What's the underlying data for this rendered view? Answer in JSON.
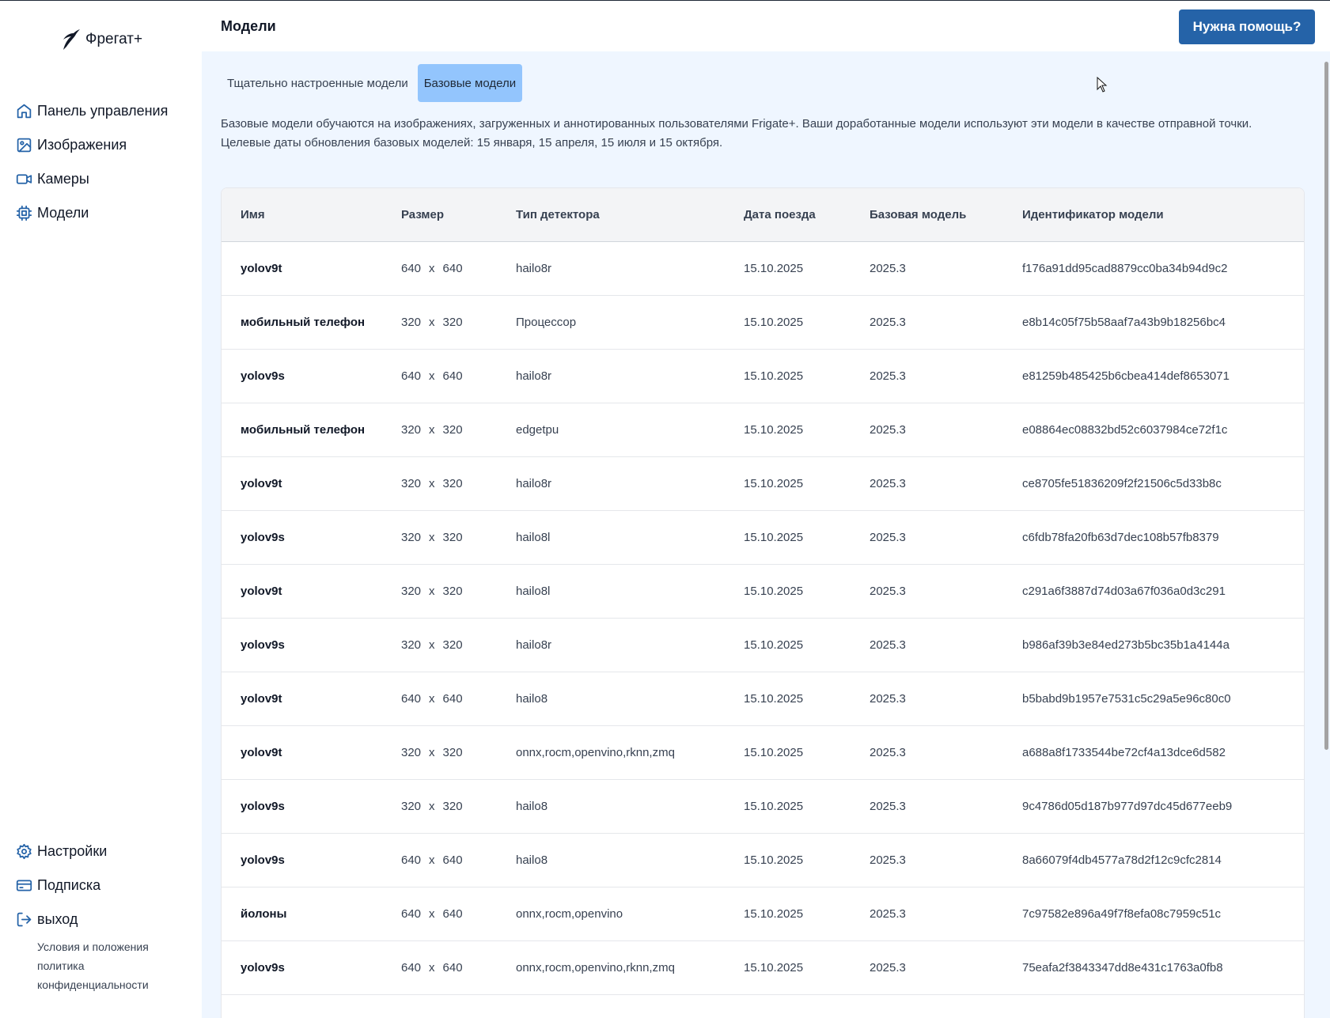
{
  "brand": {
    "name": "Фрегат+"
  },
  "sidebar": {
    "nav": [
      {
        "label": "Панель управления",
        "icon": "home-icon"
      },
      {
        "label": "Изображения",
        "icon": "image-icon"
      },
      {
        "label": "Камеры",
        "icon": "video-icon"
      },
      {
        "label": "Модели",
        "icon": "cpu-icon"
      }
    ],
    "bottom": [
      {
        "label": "Настройки",
        "icon": "gear-icon"
      },
      {
        "label": "Подписка",
        "icon": "credit-card-icon"
      },
      {
        "label": "выход",
        "icon": "logout-icon"
      }
    ],
    "legal": {
      "terms": "Условия и положения",
      "privacy_1": "политика",
      "privacy_2": "конфиденциальности"
    }
  },
  "header": {
    "title": "Модели",
    "help_button": "Нужна помощь?"
  },
  "tabs": [
    {
      "label": "Тщательно настроенные модели",
      "active": false
    },
    {
      "label": "Базовые модели",
      "active": true
    }
  ],
  "description": {
    "line1": "Базовые модели обучаются на изображениях, загруженных и аннотированных пользователями Frigate+. Ваши доработанные модели используют эти модели в качестве отправной точки.",
    "line2": "Целевые даты обновления базовых моделей: 15 января, 15 апреля, 15 июля и 15 октября."
  },
  "table": {
    "columns": [
      "Имя",
      "Размер",
      "Тип детектора",
      "Дата поезда",
      "Базовая модель",
      "Идентификатор модели"
    ],
    "size_separator": "x",
    "rows": [
      {
        "name": "yolov9t",
        "w": "640",
        "h": "640",
        "detector": "hailo8r",
        "date": "15.10.2025",
        "base": "2025.3",
        "id": "f176a91dd95cad8879cc0ba34b94d9c2"
      },
      {
        "name": "мобильный телефон",
        "w": "320",
        "h": "320",
        "detector": "Процессор",
        "date": "15.10.2025",
        "base": "2025.3",
        "id": "e8b14c05f75b58aaf7a43b9b18256bc4"
      },
      {
        "name": "yolov9s",
        "w": "640",
        "h": "640",
        "detector": "hailo8r",
        "date": "15.10.2025",
        "base": "2025.3",
        "id": "e81259b485425b6cbea414def8653071"
      },
      {
        "name": "мобильный телефон",
        "w": "320",
        "h": "320",
        "detector": "edgetpu",
        "date": "15.10.2025",
        "base": "2025.3",
        "id": "e08864ec08832bd52c6037984ce72f1c"
      },
      {
        "name": "yolov9t",
        "w": "320",
        "h": "320",
        "detector": "hailo8r",
        "date": "15.10.2025",
        "base": "2025.3",
        "id": "ce8705fe51836209f2f21506c5d33b8c"
      },
      {
        "name": "yolov9s",
        "w": "320",
        "h": "320",
        "detector": "hailo8l",
        "date": "15.10.2025",
        "base": "2025.3",
        "id": "c6fdb78fa20fb63d7dec108b57fb8379"
      },
      {
        "name": "yolov9t",
        "w": "320",
        "h": "320",
        "detector": "hailo8l",
        "date": "15.10.2025",
        "base": "2025.3",
        "id": "c291a6f3887d74d03a67f036a0d3c291"
      },
      {
        "name": "yolov9s",
        "w": "320",
        "h": "320",
        "detector": "hailo8r",
        "date": "15.10.2025",
        "base": "2025.3",
        "id": "b986af39b3e84ed273b5bc35b1a4144a"
      },
      {
        "name": "yolov9t",
        "w": "640",
        "h": "640",
        "detector": "hailo8",
        "date": "15.10.2025",
        "base": "2025.3",
        "id": "b5babd9b1957e7531c5c29a5e96c80c0"
      },
      {
        "name": "yolov9t",
        "w": "320",
        "h": "320",
        "detector": "onnx,rocm,openvino,rknn,zmq",
        "date": "15.10.2025",
        "base": "2025.3",
        "id": "a688a8f1733544be72cf4a13dce6d582"
      },
      {
        "name": "yolov9s",
        "w": "320",
        "h": "320",
        "detector": "hailo8",
        "date": "15.10.2025",
        "base": "2025.3",
        "id": "9c4786d05d187b977d97dc45d677eeb9"
      },
      {
        "name": "yolov9s",
        "w": "640",
        "h": "640",
        "detector": "hailo8",
        "date": "15.10.2025",
        "base": "2025.3",
        "id": "8a66079f4db4577a78d2f12c9cfc2814"
      },
      {
        "name": "йолоны",
        "w": "640",
        "h": "640",
        "detector": "onnx,rocm,openvino",
        "date": "15.10.2025",
        "base": "2025.3",
        "id": "7c97582e896a49f7f8efa08c7959c51c"
      },
      {
        "name": "yolov9s",
        "w": "640",
        "h": "640",
        "detector": "onnx,rocm,openvino,rknn,zmq",
        "date": "15.10.2025",
        "base": "2025.3",
        "id": "75eafa2f3843347dd8e431c1763a0fb8"
      }
    ]
  },
  "colors": {
    "accent": "#2563a8",
    "tab_active": "#93c5fd",
    "main_bg": "#eff6ff",
    "icon": "#2563a8"
  }
}
